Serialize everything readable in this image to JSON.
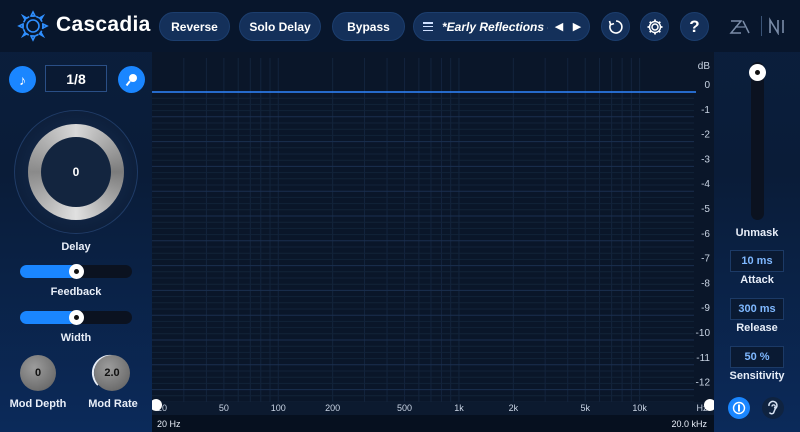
{
  "app": {
    "title": "Cascadia"
  },
  "header": {
    "reverse_label": "Reverse",
    "solo_delay_label": "Solo Delay",
    "bypass_label": "Bypass",
    "preset_name": "*Early Reflections - W...",
    "prev_arrow": "◀",
    "next_arrow": "▶",
    "help_label": "?"
  },
  "left": {
    "time_value": "1/8",
    "delay_value": "0",
    "delay_label": "Delay",
    "feedback_label": "Feedback",
    "feedback_fraction": 0.5,
    "width_label": "Width",
    "width_fraction": 0.5,
    "mod_depth_value": "0",
    "mod_depth_label": "Mod Depth",
    "mod_rate_value": "2.0",
    "mod_rate_label": "Mod Rate"
  },
  "graph": {
    "unit_label": "dB",
    "db_ticks": [
      "0",
      "-1",
      "-2",
      "-3",
      "-4",
      "-5",
      "-6",
      "-7",
      "-8",
      "-9",
      "-10",
      "-11",
      "-12"
    ],
    "freq_ticks": [
      "20",
      "50",
      "100",
      "200",
      "500",
      "1k",
      "2k",
      "5k",
      "10k",
      "Hz"
    ],
    "low_freq_readout": "20 Hz",
    "high_freq_readout": "20.0 kHz",
    "line_color": "#2f86ff"
  },
  "right": {
    "unmask_label": "Unmask",
    "unmask_fraction": 1.0,
    "attack_value": "10 ms",
    "attack_label": "Attack",
    "release_value": "300 ms",
    "release_label": "Release",
    "sensitivity_value": "50 %",
    "sensitivity_label": "Sensitivity"
  },
  "colors": {
    "accent": "#1a86ff",
    "background": "#0b1f3d"
  },
  "icons": [
    "cascadia-logo-icon",
    "list-icon",
    "history-icon",
    "gear-icon",
    "help-icon",
    "izotope-icon",
    "ni-icon",
    "note-icon",
    "tap-icon",
    "compare-icon",
    "ear-icon"
  ]
}
